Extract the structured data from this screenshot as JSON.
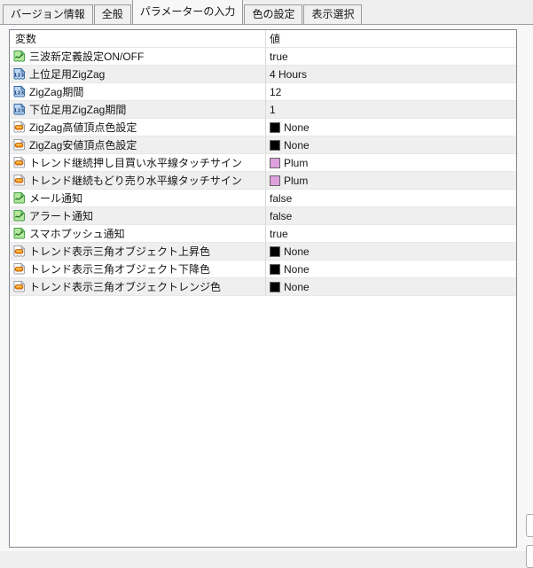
{
  "tabs": [
    {
      "label": "バージョン情報",
      "active": false
    },
    {
      "label": "全般",
      "active": false
    },
    {
      "label": "パラメーターの入力",
      "active": true
    },
    {
      "label": "色の設定",
      "active": false
    },
    {
      "label": "表示選択",
      "active": false
    }
  ],
  "table": {
    "columns": [
      "変数",
      "値"
    ],
    "rows": [
      {
        "icon": "bool-param-icon",
        "name": "三波新定義設定ON/OFF",
        "value": "true"
      },
      {
        "icon": "number-param-icon",
        "name": "上位足用ZigZag",
        "value": "4 Hours"
      },
      {
        "icon": "number-param-icon",
        "name": "ZigZag期間",
        "value": "12"
      },
      {
        "icon": "number-param-icon",
        "name": "下位足用ZigZag期間",
        "value": "1"
      },
      {
        "icon": "color-param-icon",
        "name": "ZigZag高値頂点色設定",
        "value": "None",
        "swatch": "#000000"
      },
      {
        "icon": "color-param-icon",
        "name": "ZigZag安値頂点色設定",
        "value": "None",
        "swatch": "#000000"
      },
      {
        "icon": "color-param-icon",
        "name": "トレンド継続押し目買い水平線タッチサイン",
        "value": "Plum",
        "swatch": "#DDA0DD"
      },
      {
        "icon": "color-param-icon",
        "name": "トレンド継続もどり売り水平線タッチサイン",
        "value": "Plum",
        "swatch": "#DDA0DD"
      },
      {
        "icon": "bool-param-icon",
        "name": "メール通知",
        "value": "false"
      },
      {
        "icon": "bool-param-icon",
        "name": "アラート通知",
        "value": "false"
      },
      {
        "icon": "bool-param-icon",
        "name": "スマホプッシュ通知",
        "value": "true"
      },
      {
        "icon": "color-param-icon",
        "name": "トレンド表示三角オブジェクト上昇色",
        "value": "None",
        "swatch": "#000000"
      },
      {
        "icon": "color-param-icon",
        "name": "トレンド表示三角オブジェクト下降色",
        "value": "None",
        "swatch": "#000000"
      },
      {
        "icon": "color-param-icon",
        "name": "トレンド表示三角オブジェクトレンジ色",
        "value": "None",
        "swatch": "#000000"
      }
    ]
  },
  "colors": {
    "plum_swatch": "#DDA0DD",
    "none_swatch": "#000000",
    "row_stripe": "#EFEFEF",
    "panel_bg": "#F7F7F7",
    "table_border": "#828691"
  }
}
